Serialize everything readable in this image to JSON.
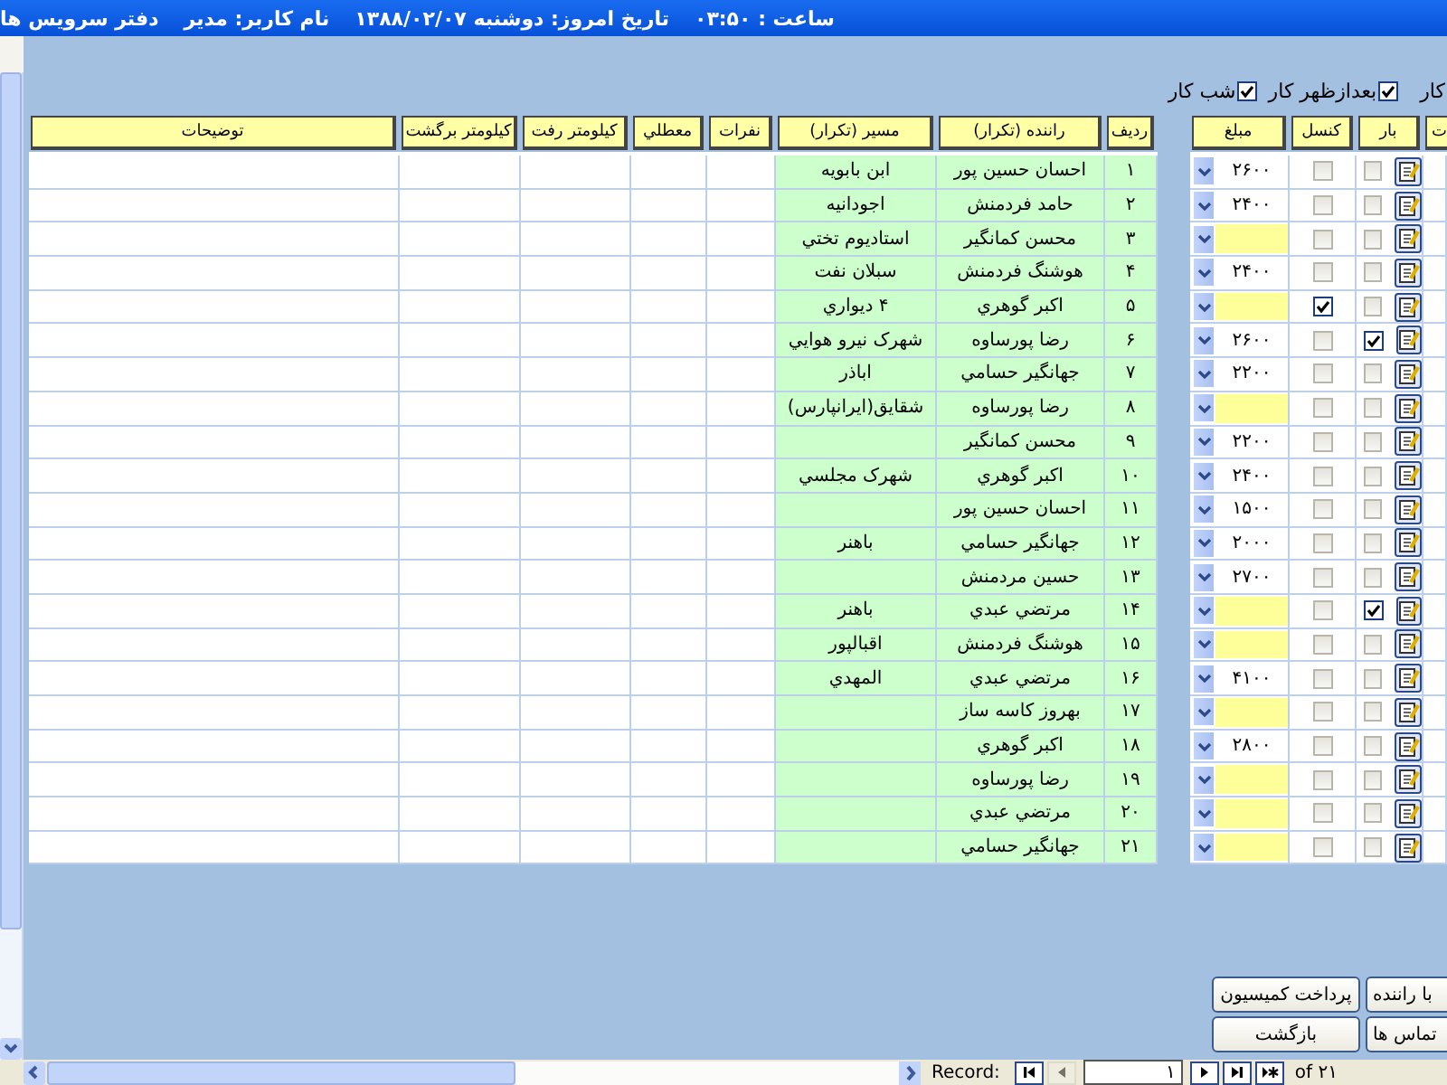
{
  "title_bar": {
    "app_title": "دفتر سرویس ها",
    "user": "نام کاربر: مدیر",
    "date": "تاریخ امروز: دوشنبه ۱۳۸۸/۰۲/۰۷",
    "time": "ساعت : ۰۳:۵۰"
  },
  "shift_filter_cut_label": "کار",
  "shift_filters": [
    {
      "label": "بعدازظهر کار",
      "checked": true
    },
    {
      "label": "شب کار",
      "checked": true
    }
  ],
  "table": {
    "columns_right": [
      "ت",
      "بار",
      "کنسل",
      "مبلغ"
    ],
    "columns_left": [
      "ردیف",
      "راننده (تکرار)",
      "مسیر (تکرار)",
      "نفرات",
      "معطلي",
      "کیلومتر رفت",
      "کیلومتر برگشت",
      "توضیحات"
    ],
    "rows": [
      {
        "row_no": "۱",
        "driver": "احسان حسین پور",
        "route": "ابن بابویه",
        "amount": "۲۶۰۰",
        "cancelled": false,
        "bar_checked": false
      },
      {
        "row_no": "۲",
        "driver": "حامد فردمنش",
        "route": "اجودانیه",
        "amount": "۲۴۰۰",
        "cancelled": false,
        "bar_checked": false
      },
      {
        "row_no": "۳",
        "driver": "محسن کمانگیر",
        "route": "استادیوم تختي",
        "cancelled": false,
        "bar_checked": false
      },
      {
        "row_no": "۴",
        "driver": "هوشنگ فردمنش",
        "route": "سبلان نفت",
        "amount": "۲۴۰۰",
        "cancelled": false,
        "bar_checked": false
      },
      {
        "row_no": "۵",
        "driver": "اکبر گوهري",
        "route": "۴ دیواري",
        "cancelled": true,
        "bar_checked": false
      },
      {
        "row_no": "۶",
        "driver": "رضا پورساوه",
        "route": "شهرک نیرو هوايي",
        "amount": "۲۶۰۰",
        "cancelled": false,
        "bar_checked": true
      },
      {
        "row_no": "۷",
        "driver": "جهانگیر حسامي",
        "route": "اباذر",
        "amount": "۲۲۰۰",
        "cancelled": false,
        "bar_checked": false
      },
      {
        "row_no": "۸",
        "driver": "رضا پورساوه",
        "route": "شقایق(ایرانپارس)",
        "cancelled": false,
        "bar_checked": false
      },
      {
        "row_no": "۹",
        "driver": "محسن کمانگیر",
        "amount": "۲۲۰۰",
        "cancelled": false,
        "bar_checked": false
      },
      {
        "row_no": "۱۰",
        "driver": "اکبر گوهري",
        "route": "شهرک مجلسي",
        "amount": "۲۴۰۰",
        "cancelled": false,
        "bar_checked": false
      },
      {
        "row_no": "۱۱",
        "driver": "احسان حسین پور",
        "amount": "۱۵۰۰",
        "cancelled": false,
        "bar_checked": false
      },
      {
        "row_no": "۱۲",
        "driver": "جهانگیر حسامي",
        "route": "باهنر",
        "amount": "۲۰۰۰",
        "cancelled": false,
        "bar_checked": false
      },
      {
        "row_no": "۱۳",
        "driver": "حسین مردمنش",
        "amount": "۲۷۰۰",
        "cancelled": false,
        "bar_checked": false
      },
      {
        "row_no": "۱۴",
        "driver": "مرتضي عبدي",
        "route": "باهنر",
        "cancelled": false,
        "bar_checked": true
      },
      {
        "row_no": "۱۵",
        "driver": "هوشنگ فردمنش",
        "route": "اقبالپور",
        "cancelled": false,
        "bar_checked": false
      },
      {
        "row_no": "۱۶",
        "driver": "مرتضي عبدي",
        "route": "المهدي",
        "amount": "۴۱۰۰",
        "cancelled": false,
        "bar_checked": false
      },
      {
        "row_no": "۱۷",
        "driver": "بهروز کاسه ساز",
        "cancelled": false,
        "bar_checked": false
      },
      {
        "row_no": "۱۸",
        "driver": "اکبر گوهري",
        "amount": "۲۸۰۰",
        "cancelled": false,
        "bar_checked": false
      },
      {
        "row_no": "۱۹",
        "driver": "رضا پورساوه",
        "cancelled": false,
        "bar_checked": false
      },
      {
        "row_no": "۲۰",
        "driver": "مرتضي عبدي",
        "cancelled": false,
        "bar_checked": false
      },
      {
        "row_no": "۲۱",
        "driver": "جهانگیر حسامي",
        "cancelled": false,
        "bar_checked": false
      }
    ]
  },
  "button_rows": [
    {
      "buttons": [
        "با راننده",
        "پرداخت کمیسیون"
      ]
    },
    {
      "buttons": [
        "تماس ها",
        "بازگشت"
      ]
    }
  ],
  "record_navigator": {
    "label": "Record:",
    "current": "۱",
    "total": "of ۲۱",
    "buttons": [
      {
        "kind": "first",
        "disabled": false
      },
      {
        "kind": "previous",
        "disabled": true
      },
      {
        "kind": "next",
        "disabled": false
      },
      {
        "kind": "last",
        "disabled": false
      },
      {
        "kind": "new",
        "disabled": false
      }
    ]
  }
}
